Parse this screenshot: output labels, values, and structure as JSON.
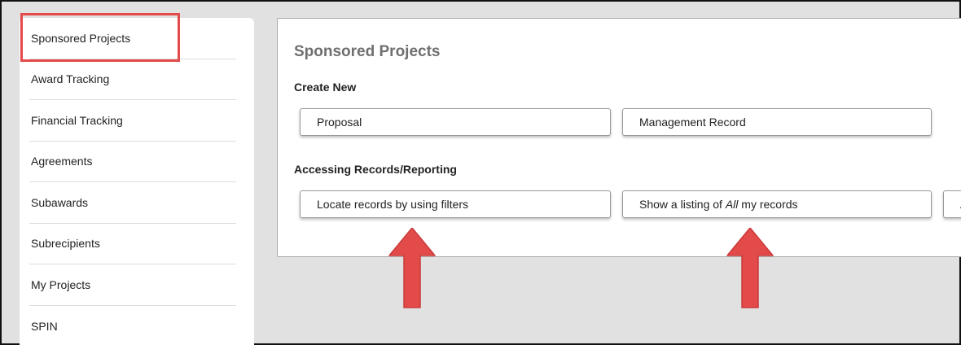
{
  "sidebar": {
    "items": [
      {
        "label": "Sponsored Projects"
      },
      {
        "label": "Award Tracking"
      },
      {
        "label": "Financial Tracking"
      },
      {
        "label": "Agreements"
      },
      {
        "label": "Subawards"
      },
      {
        "label": "Subrecipients"
      },
      {
        "label": "My Projects"
      },
      {
        "label": "SPIN"
      }
    ]
  },
  "main": {
    "title": "Sponsored Projects",
    "create_new": {
      "heading": "Create New",
      "proposal_label": "Proposal",
      "management_record_label": "Management Record"
    },
    "accessing": {
      "heading": "Accessing Records/Reporting",
      "locate_label": "Locate records by using filters",
      "show_listing_prefix": "Show a listing of ",
      "show_listing_emphasis": "All",
      "show_listing_suffix": " my records",
      "partial_button_label": "A"
    }
  },
  "colors": {
    "highlight": "#e34a4a",
    "arrow": "#e34a4a",
    "background": "#e1e1e1"
  }
}
